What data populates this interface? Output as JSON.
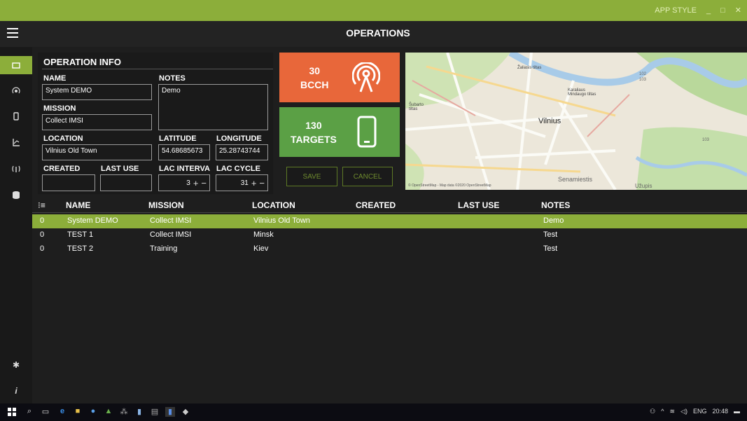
{
  "titlebar": {
    "app_style": "APP STYLE",
    "min": "_",
    "max": "□",
    "close": "✕"
  },
  "header": {
    "title": "OPERATIONS"
  },
  "sidebar": {
    "items": [
      {
        "icon": "operations-icon",
        "active": true
      },
      {
        "icon": "antenna-icon"
      },
      {
        "icon": "phone-icon"
      },
      {
        "icon": "chart-icon"
      },
      {
        "icon": "signal-icon"
      },
      {
        "icon": "database-icon"
      }
    ],
    "bottom": [
      {
        "icon": "gear-icon"
      },
      {
        "icon": "info-icon"
      }
    ]
  },
  "opinfo": {
    "title": "OPERATION INFO",
    "name_label": "NAME",
    "name_value": "System DEMO",
    "notes_label": "NOTES",
    "notes_value": "Demo",
    "mission_label": "MISSION",
    "mission_value": "Collect IMSI",
    "location_label": "LOCATION",
    "location_value": "Vilnius Old Town",
    "latitude_label": "LATITUDE",
    "latitude_value": "54.68685673",
    "longitude_label": "LONGITUDE",
    "longitude_value": "25.28743744",
    "created_label": "CREATED",
    "created_value": "",
    "last_use_label": "LAST USE",
    "last_use_value": "",
    "lac_interval_label": "LAC INTERVA",
    "lac_interval_value": "3",
    "lac_cycle_label": "LAC CYCLE",
    "lac_cycle_value": "31",
    "plus": "+",
    "minus": "−"
  },
  "tiles": {
    "bcch_count": "30",
    "bcch_label": "BCCH",
    "targets_count": "130",
    "targets_label": "TARGETS",
    "save_label": "SAVE",
    "cancel_label": "CANCEL"
  },
  "colors": {
    "accent": "#8cae3a",
    "bcch": "#e8673a",
    "targets": "#5ba045"
  },
  "map": {
    "attribution": "© OpenStreetMap - Map data ©2020 OpenStreetMap",
    "labels": [
      "Žaliasis tiltas",
      "Karaliaus Mindaugo tiltas",
      "Vilnius",
      "Senamiestis",
      "Užupis",
      "Šubarto tiltas",
      "102",
      "103",
      "103"
    ]
  },
  "table": {
    "sort_icon": "sort-icon",
    "headers": [
      "NAME",
      "MISSION",
      "LOCATION",
      "CREATED",
      "LAST USE",
      "NOTES"
    ],
    "rows": [
      {
        "id": "0",
        "name": "System DEMO",
        "mission": "Collect IMSI",
        "location": "Vilnius Old Town",
        "created": "",
        "last_use": "",
        "notes": "Demo"
      },
      {
        "id": "0",
        "name": "TEST 1",
        "mission": "Collect IMSI",
        "location": "Minsk",
        "created": "",
        "last_use": "",
        "notes": "Test"
      },
      {
        "id": "0",
        "name": "TEST 2",
        "mission": "Training",
        "location": "Kiev",
        "created": "",
        "last_use": "",
        "notes": "Test"
      }
    ]
  },
  "taskbar": {
    "lang": "ENG",
    "time": "20:48"
  }
}
